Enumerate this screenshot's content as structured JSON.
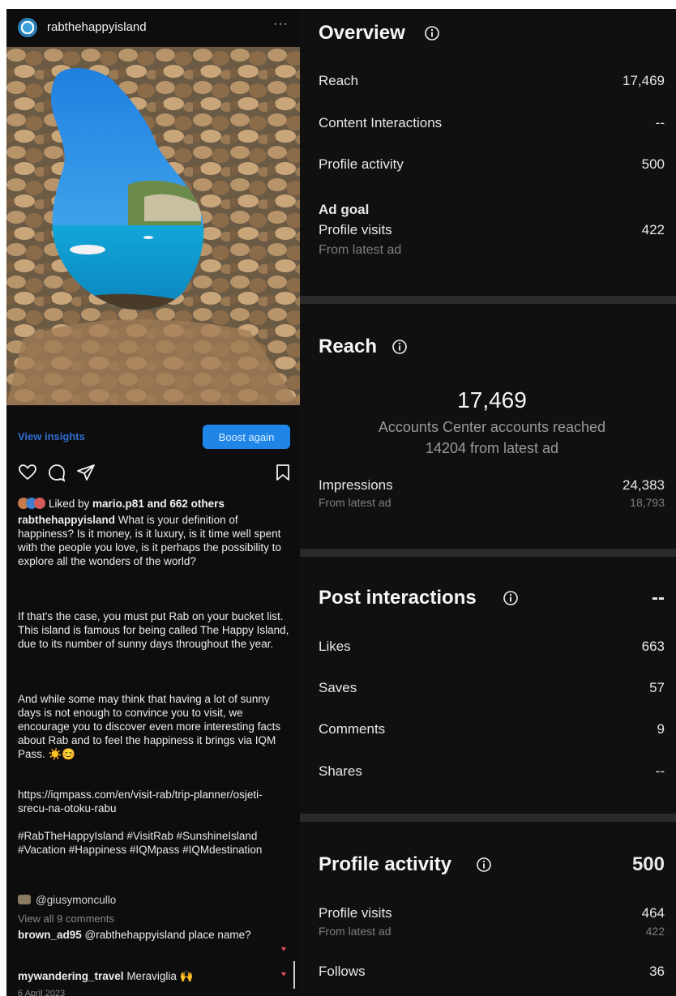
{
  "post": {
    "username": "rabthehappyisland",
    "more_label": "···",
    "view_insights_label": "View insights",
    "boost_label": "Boost again",
    "liked_prefix": "Liked by ",
    "liked_user": "mario.p81",
    "liked_suffix": " and 662 others",
    "caption_user": "rabthehappyisland",
    "caption_p1": " What is your definition of happiness? Is it money, is it luxury, is it time well spent with the people you love, is it perhaps the possibility to explore all the wonders of the world?",
    "caption_p2": "If that's the case, you must put Rab on your bucket list. This island is famous for being called The Happy Island, due to its number of sunny days throughout the year.",
    "caption_p3": "And while some may think that having a lot of sunny days is not enough to convince you to visit, we encourage you to discover even more interesting facts about Rab and to feel the happiness it brings via IQM Pass. ☀️😊",
    "caption_link": "https://iqmpass.com/en/visit-rab/trip-planner/osjeti-srecu-na-otoku-rabu",
    "hashtags": "#RabTheHappyIsland #VisitRab #SunshineIsland #Vacation #Happiness #IQMpass #IQMdestination",
    "mention": "@giusymoncullo",
    "view_all_comments": "View all 9 comments",
    "comments": [
      {
        "user": "brown_ad95",
        "text": " @rabthehappyisland place name?"
      },
      {
        "user": "mywandering_travel",
        "text": " Meraviglia 🙌"
      }
    ],
    "date": "6 April 2023"
  },
  "insights": {
    "overview": {
      "title": "Overview",
      "reach_label": "Reach",
      "reach_value": "17,469",
      "content_interactions_label": "Content Interactions",
      "content_interactions_value": "--",
      "profile_activity_label": "Profile activity",
      "profile_activity_value": "500",
      "ad_goal_label": "Ad goal",
      "profile_visits_label": "Profile visits",
      "profile_visits_value": "422",
      "from_latest_ad": "From latest ad"
    },
    "reach": {
      "title": "Reach",
      "big_value": "17,469",
      "accounts_label": "Accounts Center accounts reached",
      "from_latest_ad_line": "14204 from latest ad",
      "impressions_label": "Impressions",
      "impressions_value": "24,383",
      "impressions_sub_label": "From latest ad",
      "impressions_sub_value": "18,793"
    },
    "post_interactions": {
      "title": "Post interactions",
      "total": "--",
      "likes_label": "Likes",
      "likes_value": "663",
      "saves_label": "Saves",
      "saves_value": "57",
      "comments_label": "Comments",
      "comments_value": "9",
      "shares_label": "Shares",
      "shares_value": "--"
    },
    "profile_activity": {
      "title": "Profile activity",
      "total": "500",
      "profile_visits_label": "Profile visits",
      "profile_visits_value": "464",
      "from_latest_ad_label": "From latest ad",
      "from_latest_ad_value": "422",
      "follows_label": "Follows",
      "follows_value": "36"
    }
  },
  "colors": {
    "accent_blue": "#1f86e8",
    "heart_red": "#e04a5f",
    "panel_bg": "#101010"
  },
  "icons": [
    "info-icon",
    "heart-icon",
    "comment-icon",
    "share-icon",
    "bookmark-icon",
    "more-icon"
  ]
}
